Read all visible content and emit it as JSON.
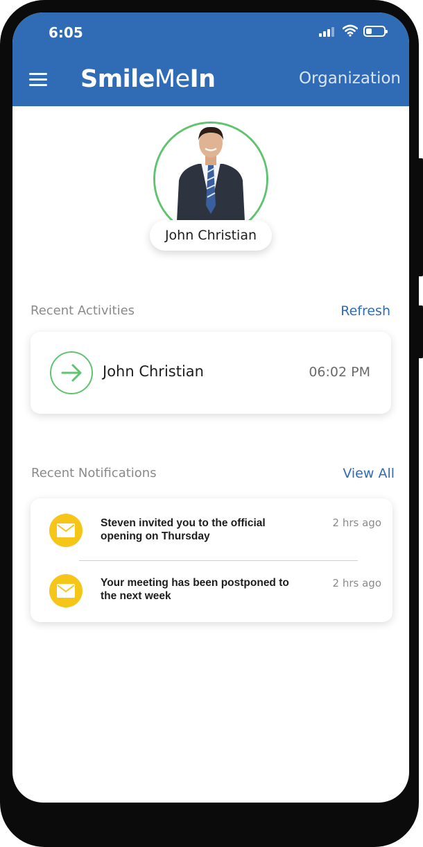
{
  "status_bar": {
    "time": "6:05",
    "icons": [
      "cellular-signal-icon",
      "wifi-icon",
      "battery-icon"
    ]
  },
  "header": {
    "menu_icon": "hamburger-menu-icon",
    "brand_bold": "Smile",
    "brand_light": "Me",
    "brand_bold_end": "In",
    "organization_link": "Organization",
    "color": "#2f6cb5"
  },
  "profile": {
    "name": "John Christian",
    "avatar": "user-photo",
    "ring_color": "#5fc46f"
  },
  "recent_activities": {
    "title": "Recent Activities",
    "action_label": "Refresh",
    "items": [
      {
        "icon": "arrow-right-icon",
        "name": "John Christian",
        "time": "06:02 PM"
      }
    ]
  },
  "recent_notifications": {
    "title": "Recent Notifications",
    "action_label": "View All",
    "items": [
      {
        "icon": "mail-icon",
        "text": "Steven invited you to the official opening on Thursday",
        "time": "2 hrs ago"
      },
      {
        "icon": "mail-icon",
        "text": "Your meeting has been postponed to the next week",
        "time": "2 hrs ago"
      }
    ],
    "icon_color": "#f5c518"
  }
}
